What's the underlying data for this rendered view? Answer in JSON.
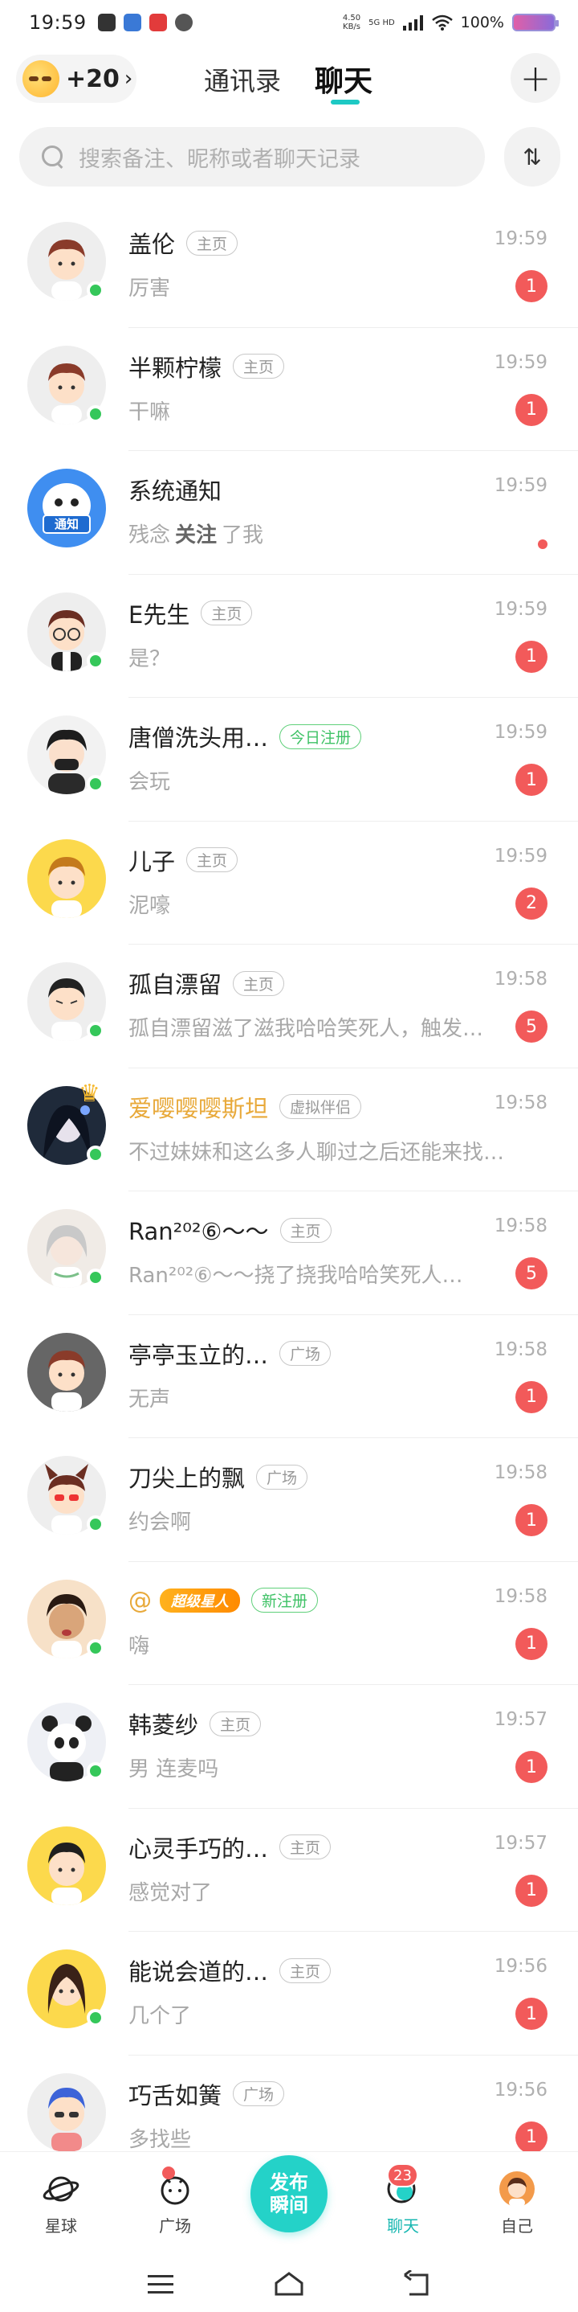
{
  "status_bar": {
    "time": "19:59",
    "net_speed": "4.50\nKB/s",
    "net_type": "5G HD",
    "battery": "100%"
  },
  "header": {
    "points": "+20",
    "points_chevron": "›",
    "tab_contacts": "通讯录",
    "tab_chat": "聊天",
    "add_symbol": "+"
  },
  "search": {
    "placeholder": "搜索备注、昵称或者聊天记录",
    "sort_symbol": "⇅"
  },
  "chats": [
    {
      "name": "盖伦",
      "tag": "主页",
      "time": "19:59",
      "msg": "厉害",
      "unread": "1",
      "avatar": "boy-brown",
      "online": true
    },
    {
      "name": "半颗柠檬",
      "tag": "主页",
      "time": "19:59",
      "msg": "干嘛",
      "unread": "1",
      "avatar": "boy-brown",
      "online": true
    },
    {
      "name": "系统通知",
      "time": "19:59",
      "msg_pre": "残念",
      "msg_bold": "关注",
      "msg_post": "了我",
      "avatar": "notice-robot",
      "online": false
    },
    {
      "name": "E先生",
      "tag": "主页",
      "time": "19:59",
      "msg": "是？",
      "unread": "1",
      "avatar": "boy-glasses",
      "online": true
    },
    {
      "name": "唐僧洗头用…",
      "tag": "今日注册",
      "time": "19:59",
      "msg": "会玩",
      "unread": "1",
      "avatar": "boy-mask",
      "online": true
    },
    {
      "name": "儿子",
      "tag": "主页",
      "time": "19:59",
      "msg": "泥嚎",
      "unread": "2",
      "avatar": "boy-yellow",
      "online": false
    },
    {
      "name": "孤自漂留",
      "tag": "主页",
      "time": "19:58",
      "msg": "孤自漂留滋了滋我哈哈笑死人，触发…",
      "unread": "5",
      "avatar": "boy-angry",
      "online": true
    },
    {
      "name": "爱嘤嘤嘤斯坦",
      "tag": "虚拟伴侣",
      "time": "19:58",
      "msg": "不过妹妹和这么多人聊过之后还能来找我…",
      "avatar": "girl-dark",
      "online": true
    },
    {
      "name": "Ran²⁰²⑥～～",
      "tag": "主页",
      "time": "19:58",
      "msg": "Ran²⁰²⑥～～挠了挠我哈哈笑死人…",
      "unread": "5",
      "avatar": "girl-white",
      "online": true
    },
    {
      "name": "亭亭玉立的…",
      "tag": "广场",
      "time": "19:58",
      "msg": "无声",
      "unread": "1",
      "avatar": "boy-grey",
      "online": false
    },
    {
      "name": "刀尖上的飘",
      "tag": "广场",
      "time": "19:58",
      "msg": "约会啊",
      "unread": "1",
      "avatar": "devil",
      "online": true
    },
    {
      "name": "@",
      "star_tag": "超级星人",
      "tag": "新注册",
      "time": "19:58",
      "msg": "嗨",
      "unread": "1",
      "avatar": "boy-tan",
      "online": true
    },
    {
      "name": "韩菱纱",
      "tag": "主页",
      "time": "19:57",
      "msg": "男 连麦吗",
      "unread": "1",
      "avatar": "panda-girl",
      "online": true
    },
    {
      "name": "心灵手巧的…",
      "tag": "主页",
      "time": "19:57",
      "msg": "感觉对了",
      "unread": "1",
      "avatar": "boy-yellow2",
      "online": false
    },
    {
      "name": "能说会道的…",
      "tag": "主页",
      "time": "19:56",
      "msg": "几个了",
      "unread": "1",
      "avatar": "girl-yellow",
      "online": true
    },
    {
      "name": "巧舌如簧",
      "tag": "广场",
      "time": "19:56",
      "msg": "多找些",
      "unread": "1",
      "avatar": "boy-blue",
      "online": false
    }
  ],
  "bottom_nav": {
    "planet": "星球",
    "square": "广场",
    "publish_line1": "发布",
    "publish_line2": "瞬间",
    "chat": "聊天",
    "chat_badge": "23",
    "me": "自己"
  },
  "colors": {
    "accent": "#1ec9c4",
    "unread": "#f25a5a",
    "online": "#35c75a"
  }
}
